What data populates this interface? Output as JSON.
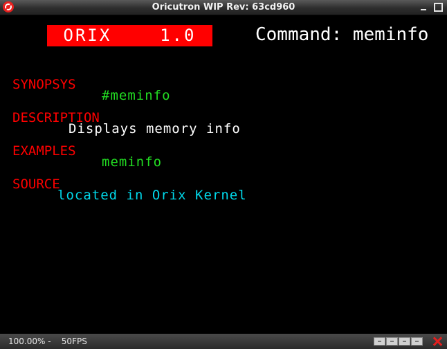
{
  "window": {
    "title": "Oricutron WIP Rev: 63cd960"
  },
  "header": {
    "os_label": "ORIX    1.0",
    "command_text": "Command: meminfo"
  },
  "sections": [
    {
      "heading": "SYNOPSYS",
      "value": "#meminfo",
      "color": "#22dd22"
    },
    {
      "heading": "DESCRIPTION",
      "value": "Displays memory info",
      "color": "#ffffff"
    },
    {
      "heading": "EXAMPLES",
      "value": "meminfo",
      "color": "#22dd22"
    },
    {
      "heading": "SOURCE",
      "value": "located in Orix Kernel",
      "color": "#00d8ea"
    }
  ],
  "statusbar": {
    "zoom_fps": "100.00% -    50FPS"
  },
  "colors": {
    "header_bg": "#ff0000",
    "section_heading": "#ff0000",
    "screen_bg": "#000000"
  },
  "icons": {
    "app": "oricutron-app-icon",
    "minimize": "minimize-icon",
    "maximize": "maximize-icon",
    "close": "close-icon"
  }
}
